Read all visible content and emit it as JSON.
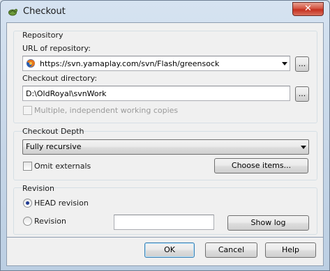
{
  "window": {
    "title": "Checkout",
    "icon": "tortoise-svn-icon",
    "close_label": "✕"
  },
  "repository": {
    "group_title": "Repository",
    "url_label": "URL of repository:",
    "url_value": "https://svn.yamaplay.com/svn/Flash/greensock",
    "url_icon": "firefox-icon",
    "browse_label": "...",
    "dir_label": "Checkout directory:",
    "dir_value": "D:\\OldRoyal\\svnWork",
    "multiple_label": "Multiple, independent working copies",
    "multiple_checked": false,
    "multiple_enabled": false
  },
  "depth": {
    "group_title": "Checkout Depth",
    "selected": "Fully recursive",
    "omit_label": "Omit externals",
    "omit_checked": false,
    "choose_label": "Choose items..."
  },
  "revision": {
    "group_title": "Revision",
    "head_label": "HEAD revision",
    "head_selected": true,
    "revision_label": "Revision",
    "revision_value": "",
    "show_log_label": "Show log"
  },
  "footer": {
    "ok_label": "OK",
    "cancel_label": "Cancel",
    "help_label": "Help"
  }
}
